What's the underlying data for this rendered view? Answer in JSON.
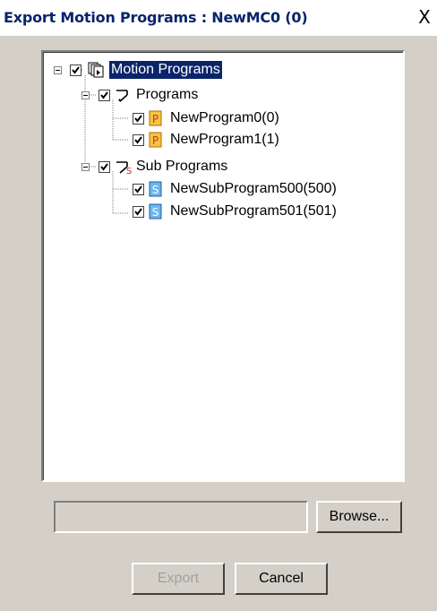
{
  "window": {
    "title": "Export Motion Programs : NewMC0 (0)",
    "close_label": "X"
  },
  "tree": {
    "root": {
      "label": "Motion Programs",
      "checked": true,
      "icon": "motion-programs-icon"
    },
    "groups": [
      {
        "label": "Programs",
        "checked": true,
        "icon": "programs-icon",
        "items": [
          {
            "label": "NewProgram0(0)",
            "checked": true,
            "icon": "program-p-icon"
          },
          {
            "label": "NewProgram1(1)",
            "checked": true,
            "icon": "program-p-icon"
          }
        ]
      },
      {
        "label": "Sub Programs",
        "checked": true,
        "icon": "sub-programs-icon",
        "items": [
          {
            "label": "NewSubProgram500(500)",
            "checked": true,
            "icon": "subprogram-s-icon"
          },
          {
            "label": "NewSubProgram501(501)",
            "checked": true,
            "icon": "subprogram-s-icon"
          }
        ]
      }
    ]
  },
  "file_path": {
    "value": "",
    "placeholder": ""
  },
  "buttons": {
    "browse": "Browse...",
    "export": "Export",
    "cancel": "Cancel"
  },
  "colors": {
    "selection_bg": "#0a246a",
    "program_icon": "#f5a623",
    "subprogram_icon": "#3a8fd8"
  }
}
